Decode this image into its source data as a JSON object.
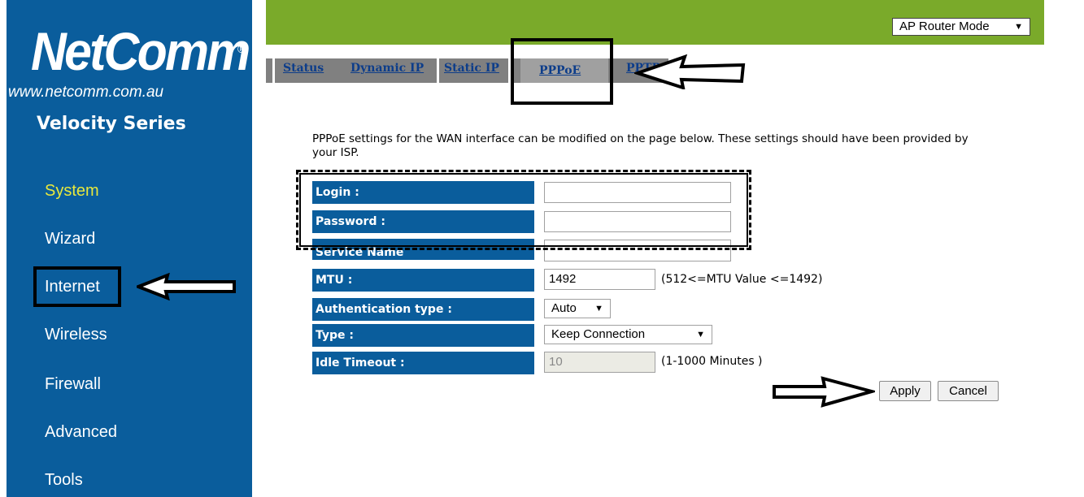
{
  "sidebar": {
    "logo_text": "NetComm",
    "logo_reg": "®",
    "url": "www.netcomm.com.au",
    "series": "Velocity Series",
    "items": [
      {
        "label": "System"
      },
      {
        "label": "Wizard"
      },
      {
        "label": "Internet"
      },
      {
        "label": "Wireless"
      },
      {
        "label": "Firewall"
      },
      {
        "label": "Advanced"
      },
      {
        "label": "Tools"
      }
    ]
  },
  "header": {
    "mode_select": "AP Router Mode"
  },
  "tabs": [
    {
      "label": "Status"
    },
    {
      "label": "Dynamic IP"
    },
    {
      "label": "Static IP"
    },
    {
      "label": "PPPoE"
    },
    {
      "label": "PPTP"
    }
  ],
  "description": "PPPoE settings for the WAN interface can be modified on the page below. These settings should have been provided by your ISP.",
  "form": {
    "login_label": "Login :",
    "login_value": "",
    "password_label": "Password :",
    "password_value": "",
    "service_name_label": "Service Name",
    "service_name_value": "",
    "mtu_label": "MTU :",
    "mtu_value": "1492",
    "mtu_hint": "(512<=MTU Value <=1492)",
    "auth_label": "Authentication type :",
    "auth_value": "Auto",
    "type_label": "Type :",
    "type_value": "Keep Connection",
    "idle_label": "Idle Timeout :",
    "idle_value": "10",
    "idle_hint": "(1-1000 Minutes )"
  },
  "buttons": {
    "apply": "Apply",
    "cancel": "Cancel"
  },
  "colors": {
    "sidebar_bg": "#0a5d9c",
    "topbar_bg": "#7aaa2a",
    "label_bg": "#0a5d9c",
    "system_highlight": "#e8e83c"
  }
}
